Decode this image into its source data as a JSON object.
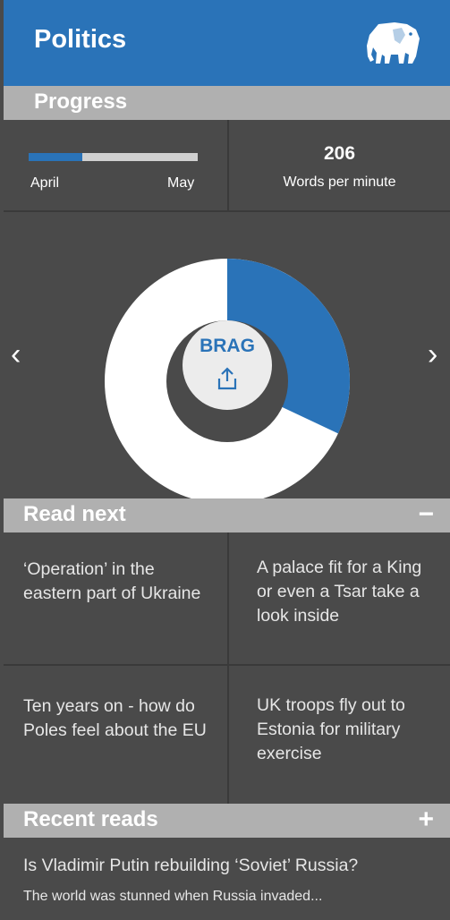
{
  "header": {
    "title": "Politics",
    "logo_icon": "elephant-icon"
  },
  "progress": {
    "section_label": "Progress",
    "month_progress": 0.32,
    "month_start": "April",
    "month_end": "May",
    "wpm_value": "206",
    "wpm_label": "Words  per minute"
  },
  "chart": {
    "highlight_fraction": 0.32,
    "brag_label": "BRAG",
    "share_icon": "share-icon",
    "prev_icon": "chevron-left-icon",
    "next_icon": "chevron-right-icon"
  },
  "read_next": {
    "section_label": "Read next",
    "toggle": "−",
    "items": [
      {
        "title": "‘Operation’ in the eastern part of Ukraine"
      },
      {
        "title": "A palace fit for a King or even a Tsar take a look inside"
      },
      {
        "title": "Ten years on - how do Poles feel about the EU"
      },
      {
        "title": "UK troops fly out to Estonia for military exercise"
      }
    ]
  },
  "recent_reads": {
    "section_label": "Recent reads",
    "toggle": "+",
    "item": {
      "title": "Is Vladimir Putin rebuilding ‘Soviet’ Russia?",
      "snippet": "The world was stunned when Russia invaded..."
    }
  },
  "colors": {
    "accent": "#2a73b8",
    "bar": "#b0b0b0",
    "background": "#4a4a4a"
  }
}
